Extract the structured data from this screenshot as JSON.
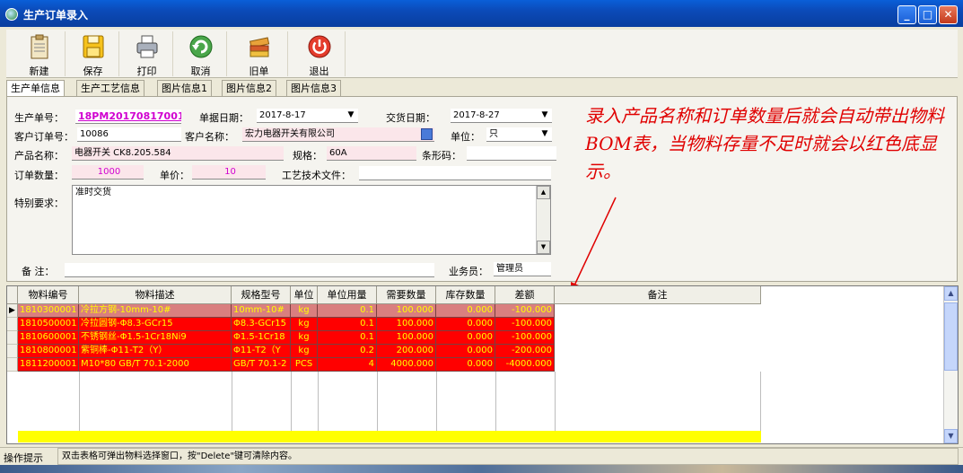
{
  "window": {
    "title": "生产订单录入"
  },
  "toolbar": {
    "new": "新建",
    "save": "保存",
    "print": "打印",
    "cancel": "取消",
    "old": "旧单",
    "exit": "退出"
  },
  "tabs": [
    "生产单信息",
    "生产工艺信息",
    "图片信息1",
    "图片信息2",
    "图片信息3"
  ],
  "form": {
    "order_no_label": "生产单号：",
    "order_no": "18PM20170817001",
    "doc_date_label": "单据日期：",
    "doc_date": "2017-8-17",
    "delivery_date_label": "交货日期：",
    "delivery_date": "2017-8-27",
    "cust_order_label": "客户订单号：",
    "cust_order": "10086",
    "cust_name_label": "客户名称：",
    "cust_name": "宏力电器开关有限公司",
    "unit_label": "单位：",
    "unit": "只",
    "product_label": "产品名称：",
    "product": "电器开关 CK8.205.584",
    "spec_label": "规格：",
    "spec": "60A",
    "barcode_label": "条形码：",
    "barcode": "",
    "qty_label": "订单数量：",
    "qty": "1000",
    "price_label": "单价：",
    "price": "10",
    "tech_label": "工艺技术文件：",
    "tech": "",
    "special_label": "特别要求：",
    "special": "准时交货",
    "remark_label": "备 注：",
    "remark": "",
    "sales_label": "业务员：",
    "sales": "管理员"
  },
  "note": "录入产品名称和订单数量后就会自动带出物料BOM表，当物料存量不足时就会以红色底显示。",
  "grid": {
    "headers": [
      "物料编号",
      "物料描述",
      "规格型号",
      "单位",
      "单位用量",
      "需要数量",
      "库存数量",
      "差额",
      "备注"
    ],
    "rows": [
      [
        "1810300001",
        "冷拉方钢-10mm-10#",
        "10mm-10#",
        "kg",
        "0.1",
        "100.000",
        "0.000",
        "-100.000",
        ""
      ],
      [
        "1810500001",
        "冷拉圆钢-Φ8.3-GCr15",
        "Φ8.3-GCr15",
        "kg",
        "0.1",
        "100.000",
        "0.000",
        "-100.000",
        ""
      ],
      [
        "1810600001",
        "不锈钢丝-Φ1.5-1Cr18Ni9",
        "Φ1.5-1Cr18",
        "kg",
        "0.1",
        "100.000",
        "0.000",
        "-100.000",
        ""
      ],
      [
        "1810800001",
        "紫铜棒-Φ11-T2（Y）",
        "Φ11-T2（Y",
        "kg",
        "0.2",
        "200.000",
        "0.000",
        "-200.000",
        ""
      ],
      [
        "1811200001",
        "M10*80 GB/T 70.1-2000",
        "GB/T 70.1-2",
        "PCS",
        "4",
        "4000.000",
        "0.000",
        "-4000.000",
        ""
      ]
    ]
  },
  "status": {
    "label": "操作提示",
    "text": "双击表格可弹出物料选择窗口，按\"Delete\"键可清除内容。"
  }
}
